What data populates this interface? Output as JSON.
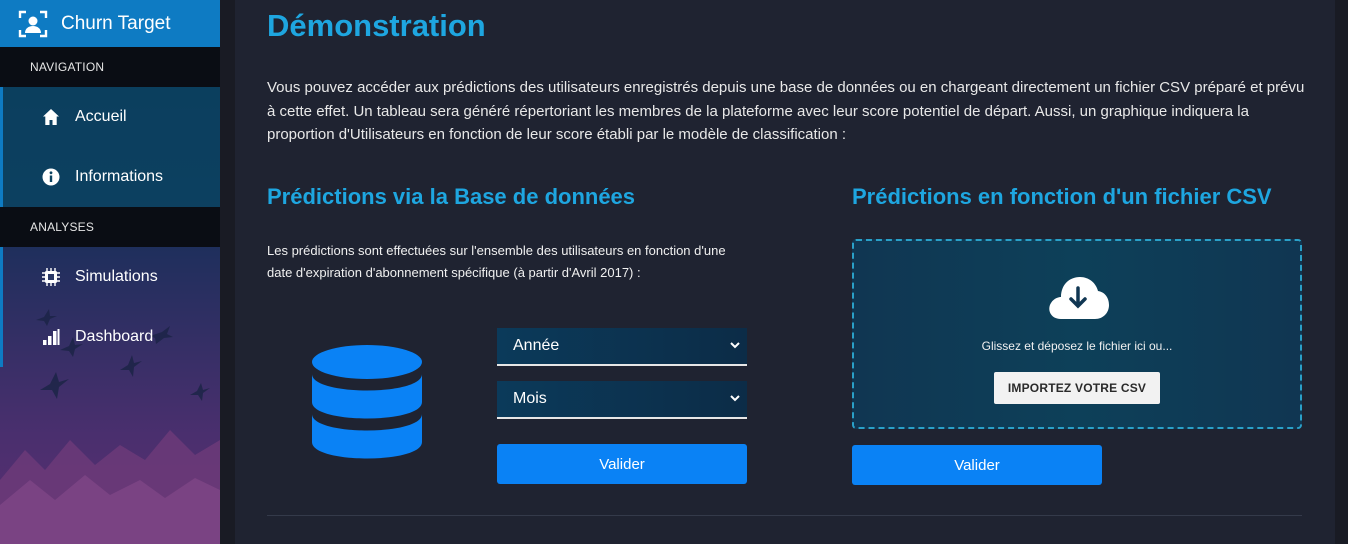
{
  "brand": {
    "title": "Churn Target",
    "icon": "user-focus-icon"
  },
  "sidebar": {
    "sections": [
      {
        "header": "NAVIGATION",
        "items": [
          {
            "label": "Accueil",
            "icon": "home-icon"
          },
          {
            "label": "Informations",
            "icon": "info-icon"
          }
        ]
      },
      {
        "header": "ANALYSES",
        "items": [
          {
            "label": "Simulations",
            "icon": "chip-icon"
          },
          {
            "label": "Dashboard",
            "icon": "bar-chart-icon"
          }
        ]
      }
    ]
  },
  "main": {
    "title": "Démonstration",
    "intro": "Vous pouvez accéder aux prédictions des utilisateurs enregistrés depuis une base de données ou en chargeant directement un fichier CSV préparé et prévu à cette effet. Un tableau sera généré répertoriant les membres de la plateforme avec leur score potentiel de départ. Aussi, un graphique indiquera la proportion d'Utilisateurs en fonction de leur score établi par le modèle de classification :",
    "db_section": {
      "title": "Prédictions via la Base de données",
      "description": "Les prédictions sont effectuées sur l'ensemble des utilisateurs en fonction d'une date d'expiration d'abonnement spécifique (à partir d'Avril 2017) :",
      "year_select": "Année",
      "month_select": "Mois",
      "submit": "Valider"
    },
    "csv_section": {
      "title": "Prédictions en fonction d'un fichier CSV",
      "drop_text": "Glissez et déposez le fichier ici ou...",
      "import_button": "IMPORTEZ VOTRE CSV",
      "submit": "Valider"
    }
  },
  "colors": {
    "accent": "#1ea6e0",
    "button": "#0a82f5",
    "brand_bar": "#0e7bc3",
    "background": "#1f2331"
  }
}
